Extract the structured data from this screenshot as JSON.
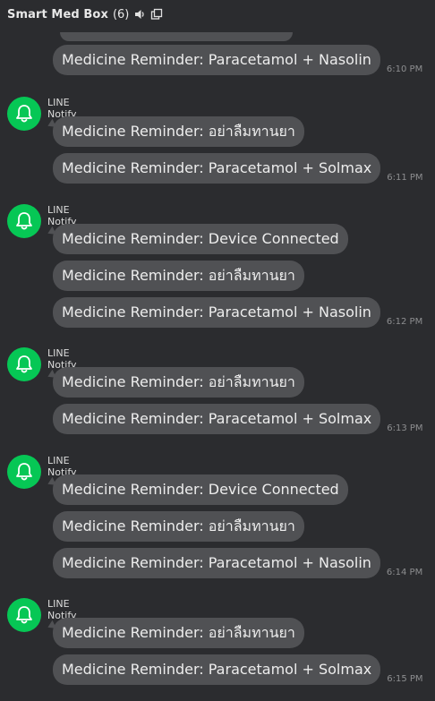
{
  "header": {
    "title": "Smart Med Box",
    "count": "(6)",
    "sound_icon": "speaker-icon",
    "popout_icon": "popout-icon"
  },
  "colors": {
    "background": "#2b2c2f",
    "bubble": "#505154",
    "avatar": "#06c755",
    "time": "#8d8e90"
  },
  "first_message": {
    "text": "Medicine Reminder: Paracetamol + Nasolin",
    "time": "6:10 PM"
  },
  "groups": [
    {
      "sender": "LINE Notify",
      "messages": [
        {
          "text": "Medicine Reminder: อย่าลืมทานยา",
          "time": ""
        },
        {
          "text": "Medicine Reminder: Paracetamol + Solmax",
          "time": "6:11 PM"
        }
      ]
    },
    {
      "sender": "LINE Notify",
      "messages": [
        {
          "text": "Medicine Reminder: Device Connected",
          "time": ""
        },
        {
          "text": "Medicine Reminder: อย่าลืมทานยา",
          "time": ""
        },
        {
          "text": "Medicine Reminder: Paracetamol + Nasolin",
          "time": "6:12 PM"
        }
      ]
    },
    {
      "sender": "LINE Notify",
      "messages": [
        {
          "text": "Medicine Reminder: อย่าลืมทานยา",
          "time": ""
        },
        {
          "text": "Medicine Reminder: Paracetamol + Solmax",
          "time": "6:13 PM"
        }
      ]
    },
    {
      "sender": "LINE Notify",
      "messages": [
        {
          "text": "Medicine Reminder: Device Connected",
          "time": ""
        },
        {
          "text": "Medicine Reminder: อย่าลืมทานยา",
          "time": ""
        },
        {
          "text": "Medicine Reminder: Paracetamol + Nasolin",
          "time": "6:14 PM"
        }
      ]
    },
    {
      "sender": "LINE Notify",
      "messages": [
        {
          "text": "Medicine Reminder: อย่าลืมทานยา",
          "time": ""
        },
        {
          "text": "Medicine Reminder: Paracetamol + Solmax",
          "time": "6:15 PM"
        }
      ]
    }
  ]
}
